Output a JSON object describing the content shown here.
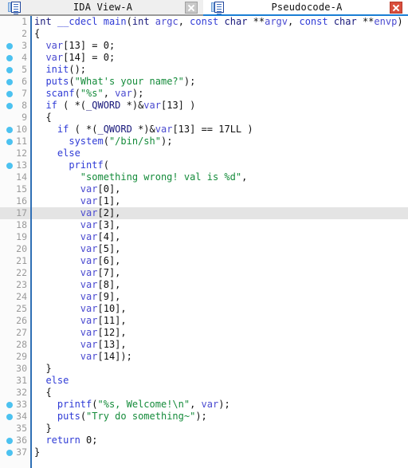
{
  "window": {
    "tabs": [
      {
        "label": "IDA View-A",
        "active": false,
        "icon": "document-icon",
        "close_icon": "close-icon",
        "close_style": "gray"
      },
      {
        "label": "Pseudocode-A",
        "active": true,
        "icon": "document-icon",
        "close_icon": "close-icon",
        "close_style": "red"
      }
    ]
  },
  "colors": {
    "accent": "#1b7fd4",
    "marker_dot": "#4cc2f0",
    "close_red": "#d94f3d",
    "highlight_row": "#e4e4e4",
    "keyword": "#2f3bd6",
    "variable": "#4a4ad0",
    "string": "#148b3a",
    "type": "#18187a"
  },
  "editor": {
    "highlighted_line": 17,
    "marker_lines": [
      3,
      4,
      5,
      6,
      7,
      8,
      10,
      11,
      13,
      33,
      34,
      36,
      37
    ],
    "lines": [
      {
        "n": 1,
        "tokens": [
          {
            "t": "typ",
            "s": "int"
          },
          {
            "t": "pl",
            "s": " "
          },
          {
            "t": "kw",
            "s": "__cdecl"
          },
          {
            "t": "pl",
            "s": " "
          },
          {
            "t": "fn",
            "s": "main"
          },
          {
            "t": "pl",
            "s": "("
          },
          {
            "t": "typ",
            "s": "int"
          },
          {
            "t": "pl",
            "s": " "
          },
          {
            "t": "var",
            "s": "argc"
          },
          {
            "t": "pl",
            "s": ", "
          },
          {
            "t": "kw",
            "s": "const"
          },
          {
            "t": "pl",
            "s": " "
          },
          {
            "t": "typ",
            "s": "char"
          },
          {
            "t": "pl",
            "s": " **"
          },
          {
            "t": "var",
            "s": "argv"
          },
          {
            "t": "pl",
            "s": ", "
          },
          {
            "t": "kw",
            "s": "const"
          },
          {
            "t": "pl",
            "s": " "
          },
          {
            "t": "typ",
            "s": "char"
          },
          {
            "t": "pl",
            "s": " **"
          },
          {
            "t": "var",
            "s": "envp"
          },
          {
            "t": "pl",
            "s": ")"
          }
        ]
      },
      {
        "n": 2,
        "tokens": [
          {
            "t": "br",
            "s": "{"
          }
        ]
      },
      {
        "n": 3,
        "tokens": [
          {
            "t": "pl",
            "s": "  "
          },
          {
            "t": "var",
            "s": "var"
          },
          {
            "t": "pl",
            "s": "["
          },
          {
            "t": "num",
            "s": "13"
          },
          {
            "t": "pl",
            "s": "] = "
          },
          {
            "t": "num",
            "s": "0"
          },
          {
            "t": "pl",
            "s": ";"
          }
        ]
      },
      {
        "n": 4,
        "tokens": [
          {
            "t": "pl",
            "s": "  "
          },
          {
            "t": "var",
            "s": "var"
          },
          {
            "t": "pl",
            "s": "["
          },
          {
            "t": "num",
            "s": "14"
          },
          {
            "t": "pl",
            "s": "] = "
          },
          {
            "t": "num",
            "s": "0"
          },
          {
            "t": "pl",
            "s": ";"
          }
        ]
      },
      {
        "n": 5,
        "tokens": [
          {
            "t": "pl",
            "s": "  "
          },
          {
            "t": "fn",
            "s": "init"
          },
          {
            "t": "pl",
            "s": "();"
          }
        ]
      },
      {
        "n": 6,
        "tokens": [
          {
            "t": "pl",
            "s": "  "
          },
          {
            "t": "fn",
            "s": "puts"
          },
          {
            "t": "pl",
            "s": "("
          },
          {
            "t": "str",
            "s": "\"What's your name?\""
          },
          {
            "t": "pl",
            "s": ");"
          }
        ]
      },
      {
        "n": 7,
        "tokens": [
          {
            "t": "pl",
            "s": "  "
          },
          {
            "t": "fn",
            "s": "scanf"
          },
          {
            "t": "pl",
            "s": "("
          },
          {
            "t": "str",
            "s": "\"%s\""
          },
          {
            "t": "pl",
            "s": ", "
          },
          {
            "t": "var",
            "s": "var"
          },
          {
            "t": "pl",
            "s": ");"
          }
        ]
      },
      {
        "n": 8,
        "tokens": [
          {
            "t": "pl",
            "s": "  "
          },
          {
            "t": "kw",
            "s": "if"
          },
          {
            "t": "pl",
            "s": " ( *("
          },
          {
            "t": "typ",
            "s": "_QWORD"
          },
          {
            "t": "pl",
            "s": " *)&"
          },
          {
            "t": "var",
            "s": "var"
          },
          {
            "t": "pl",
            "s": "["
          },
          {
            "t": "num",
            "s": "13"
          },
          {
            "t": "pl",
            "s": "] )"
          }
        ]
      },
      {
        "n": 9,
        "tokens": [
          {
            "t": "pl",
            "s": "  "
          },
          {
            "t": "br",
            "s": "{"
          }
        ]
      },
      {
        "n": 10,
        "tokens": [
          {
            "t": "pl",
            "s": "    "
          },
          {
            "t": "kw",
            "s": "if"
          },
          {
            "t": "pl",
            "s": " ( *("
          },
          {
            "t": "typ",
            "s": "_QWORD"
          },
          {
            "t": "pl",
            "s": " *)&"
          },
          {
            "t": "var",
            "s": "var"
          },
          {
            "t": "pl",
            "s": "["
          },
          {
            "t": "num",
            "s": "13"
          },
          {
            "t": "pl",
            "s": "] == "
          },
          {
            "t": "num",
            "s": "17LL"
          },
          {
            "t": "pl",
            "s": " )"
          }
        ]
      },
      {
        "n": 11,
        "tokens": [
          {
            "t": "pl",
            "s": "      "
          },
          {
            "t": "fn",
            "s": "system"
          },
          {
            "t": "pl",
            "s": "("
          },
          {
            "t": "str",
            "s": "\"/bin/sh\""
          },
          {
            "t": "pl",
            "s": ");"
          }
        ]
      },
      {
        "n": 12,
        "tokens": [
          {
            "t": "pl",
            "s": "    "
          },
          {
            "t": "kw",
            "s": "else"
          }
        ]
      },
      {
        "n": 13,
        "tokens": [
          {
            "t": "pl",
            "s": "      "
          },
          {
            "t": "fn",
            "s": "printf"
          },
          {
            "t": "pl",
            "s": "("
          }
        ]
      },
      {
        "n": 14,
        "tokens": [
          {
            "t": "pl",
            "s": "        "
          },
          {
            "t": "str",
            "s": "\"something wrong! val is %d\""
          },
          {
            "t": "pl",
            "s": ","
          }
        ]
      },
      {
        "n": 15,
        "tokens": [
          {
            "t": "pl",
            "s": "        "
          },
          {
            "t": "var",
            "s": "var"
          },
          {
            "t": "pl",
            "s": "["
          },
          {
            "t": "num",
            "s": "0"
          },
          {
            "t": "pl",
            "s": "],"
          }
        ]
      },
      {
        "n": 16,
        "tokens": [
          {
            "t": "pl",
            "s": "        "
          },
          {
            "t": "var",
            "s": "var"
          },
          {
            "t": "pl",
            "s": "["
          },
          {
            "t": "num",
            "s": "1"
          },
          {
            "t": "pl",
            "s": "],"
          }
        ]
      },
      {
        "n": 17,
        "tokens": [
          {
            "t": "pl",
            "s": "        "
          },
          {
            "t": "var",
            "s": "var"
          },
          {
            "t": "pl",
            "s": "["
          },
          {
            "t": "num",
            "s": "2"
          },
          {
            "t": "pl",
            "s": "],"
          }
        ]
      },
      {
        "n": 18,
        "tokens": [
          {
            "t": "pl",
            "s": "        "
          },
          {
            "t": "var",
            "s": "var"
          },
          {
            "t": "pl",
            "s": "["
          },
          {
            "t": "num",
            "s": "3"
          },
          {
            "t": "pl",
            "s": "],"
          }
        ]
      },
      {
        "n": 19,
        "tokens": [
          {
            "t": "pl",
            "s": "        "
          },
          {
            "t": "var",
            "s": "var"
          },
          {
            "t": "pl",
            "s": "["
          },
          {
            "t": "num",
            "s": "4"
          },
          {
            "t": "pl",
            "s": "],"
          }
        ]
      },
      {
        "n": 20,
        "tokens": [
          {
            "t": "pl",
            "s": "        "
          },
          {
            "t": "var",
            "s": "var"
          },
          {
            "t": "pl",
            "s": "["
          },
          {
            "t": "num",
            "s": "5"
          },
          {
            "t": "pl",
            "s": "],"
          }
        ]
      },
      {
        "n": 21,
        "tokens": [
          {
            "t": "pl",
            "s": "        "
          },
          {
            "t": "var",
            "s": "var"
          },
          {
            "t": "pl",
            "s": "["
          },
          {
            "t": "num",
            "s": "6"
          },
          {
            "t": "pl",
            "s": "],"
          }
        ]
      },
      {
        "n": 22,
        "tokens": [
          {
            "t": "pl",
            "s": "        "
          },
          {
            "t": "var",
            "s": "var"
          },
          {
            "t": "pl",
            "s": "["
          },
          {
            "t": "num",
            "s": "7"
          },
          {
            "t": "pl",
            "s": "],"
          }
        ]
      },
      {
        "n": 23,
        "tokens": [
          {
            "t": "pl",
            "s": "        "
          },
          {
            "t": "var",
            "s": "var"
          },
          {
            "t": "pl",
            "s": "["
          },
          {
            "t": "num",
            "s": "8"
          },
          {
            "t": "pl",
            "s": "],"
          }
        ]
      },
      {
        "n": 24,
        "tokens": [
          {
            "t": "pl",
            "s": "        "
          },
          {
            "t": "var",
            "s": "var"
          },
          {
            "t": "pl",
            "s": "["
          },
          {
            "t": "num",
            "s": "9"
          },
          {
            "t": "pl",
            "s": "],"
          }
        ]
      },
      {
        "n": 25,
        "tokens": [
          {
            "t": "pl",
            "s": "        "
          },
          {
            "t": "var",
            "s": "var"
          },
          {
            "t": "pl",
            "s": "["
          },
          {
            "t": "num",
            "s": "10"
          },
          {
            "t": "pl",
            "s": "],"
          }
        ]
      },
      {
        "n": 26,
        "tokens": [
          {
            "t": "pl",
            "s": "        "
          },
          {
            "t": "var",
            "s": "var"
          },
          {
            "t": "pl",
            "s": "["
          },
          {
            "t": "num",
            "s": "11"
          },
          {
            "t": "pl",
            "s": "],"
          }
        ]
      },
      {
        "n": 27,
        "tokens": [
          {
            "t": "pl",
            "s": "        "
          },
          {
            "t": "var",
            "s": "var"
          },
          {
            "t": "pl",
            "s": "["
          },
          {
            "t": "num",
            "s": "12"
          },
          {
            "t": "pl",
            "s": "],"
          }
        ]
      },
      {
        "n": 28,
        "tokens": [
          {
            "t": "pl",
            "s": "        "
          },
          {
            "t": "var",
            "s": "var"
          },
          {
            "t": "pl",
            "s": "["
          },
          {
            "t": "num",
            "s": "13"
          },
          {
            "t": "pl",
            "s": "],"
          }
        ]
      },
      {
        "n": 29,
        "tokens": [
          {
            "t": "pl",
            "s": "        "
          },
          {
            "t": "var",
            "s": "var"
          },
          {
            "t": "pl",
            "s": "["
          },
          {
            "t": "num",
            "s": "14"
          },
          {
            "t": "pl",
            "s": "]);"
          }
        ]
      },
      {
        "n": 30,
        "tokens": [
          {
            "t": "pl",
            "s": "  "
          },
          {
            "t": "br",
            "s": "}"
          }
        ]
      },
      {
        "n": 31,
        "tokens": [
          {
            "t": "pl",
            "s": "  "
          },
          {
            "t": "kw",
            "s": "else"
          }
        ]
      },
      {
        "n": 32,
        "tokens": [
          {
            "t": "pl",
            "s": "  "
          },
          {
            "t": "br",
            "s": "{"
          }
        ]
      },
      {
        "n": 33,
        "tokens": [
          {
            "t": "pl",
            "s": "    "
          },
          {
            "t": "fn",
            "s": "printf"
          },
          {
            "t": "pl",
            "s": "("
          },
          {
            "t": "str",
            "s": "\"%s, Welcome!\\n\""
          },
          {
            "t": "pl",
            "s": ", "
          },
          {
            "t": "var",
            "s": "var"
          },
          {
            "t": "pl",
            "s": ");"
          }
        ]
      },
      {
        "n": 34,
        "tokens": [
          {
            "t": "pl",
            "s": "    "
          },
          {
            "t": "fn",
            "s": "puts"
          },
          {
            "t": "pl",
            "s": "("
          },
          {
            "t": "str",
            "s": "\"Try do something~\""
          },
          {
            "t": "pl",
            "s": ");"
          }
        ]
      },
      {
        "n": 35,
        "tokens": [
          {
            "t": "pl",
            "s": "  "
          },
          {
            "t": "br",
            "s": "}"
          }
        ]
      },
      {
        "n": 36,
        "tokens": [
          {
            "t": "pl",
            "s": "  "
          },
          {
            "t": "kw",
            "s": "return"
          },
          {
            "t": "pl",
            "s": " "
          },
          {
            "t": "num",
            "s": "0"
          },
          {
            "t": "pl",
            "s": ";"
          }
        ]
      },
      {
        "n": 37,
        "tokens": [
          {
            "t": "br",
            "s": "}"
          }
        ]
      }
    ]
  }
}
